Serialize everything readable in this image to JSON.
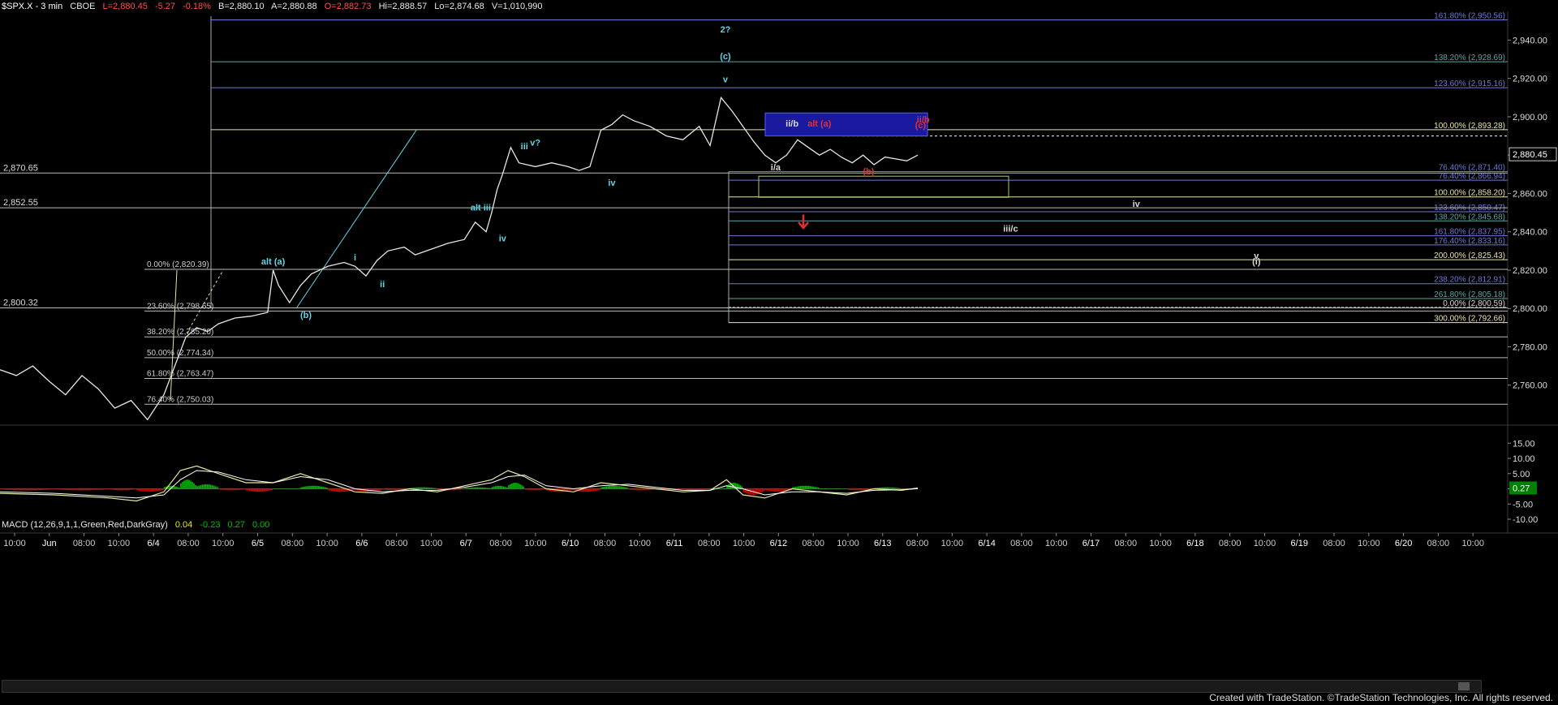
{
  "header": {
    "symbol": "$SPX.X - 3 min",
    "exchange": "CBOE",
    "last": "L=2,880.45",
    "change": "-5.27",
    "change_pct": "-0.18%",
    "bid": "B=2,880.10",
    "ask": "A=2,880.88",
    "open": "O=2,882.73",
    "high": "Hi=2,888.57",
    "low": "Lo=2,874.68",
    "volume": "V=1,010,990"
  },
  "macd_header": {
    "label": "MACD (12,26,9,1,1,Green,Red,DarkGray)",
    "v1": "0.04",
    "v2": "-0.23",
    "v3": "0.27",
    "v4": "0.00"
  },
  "footer": {
    "text": "Created with TradeStation. ©TradeStation Technologies, Inc. All rights reserved."
  },
  "colors": {
    "background": "#000000",
    "price": "#e6e6e6",
    "wave_label": "#5fd6e6",
    "red_label": "#e03030",
    "fib_blue": "#6f78d8",
    "fib_yellow": "#e6e6a8",
    "fib_white": "#d8d8d8",
    "macd_pos": "#00c000",
    "macd_neg": "#e00000"
  },
  "chart_data": [
    {
      "type": "line",
      "title": "$SPX.X - 3 min",
      "ylim": [
        2740,
        2955
      ],
      "y_ticks": [
        "2,760.00",
        "2,780.00",
        "2,800.00",
        "2,820.00",
        "2,840.00",
        "2,860.00",
        "2,880.00",
        "2,900.00",
        "2,920.00",
        "2,940.00"
      ],
      "x_ticks": [
        "10:00",
        "Jun",
        "08:00",
        "10:00",
        "6/4",
        "08:00",
        "10:00",
        "6/5",
        "08:00",
        "10:00",
        "6/6",
        "08:00",
        "10:00",
        "6/7",
        "08:00",
        "10:00",
        "6/10",
        "08:00",
        "10:00",
        "6/11",
        "08:00",
        "10:00",
        "6/12",
        "08:00",
        "10:00",
        "6/13",
        "08:00",
        "10:00",
        "6/14",
        "08:00",
        "10:00",
        "6/17",
        "08:00",
        "10:00",
        "6/18",
        "08:00",
        "10:00",
        "6/19",
        "08:00",
        "10:00",
        "6/20",
        "08:00",
        "10:00"
      ],
      "last_price": "2,880.45",
      "price_series": [
        [
          0,
          2768
        ],
        [
          0.3,
          2765
        ],
        [
          0.6,
          2770
        ],
        [
          0.9,
          2762
        ],
        [
          1.2,
          2755
        ],
        [
          1.5,
          2765
        ],
        [
          1.8,
          2758
        ],
        [
          2.1,
          2748
        ],
        [
          2.4,
          2752
        ],
        [
          2.7,
          2742
        ],
        [
          3.0,
          2755
        ],
        [
          3.2,
          2770
        ],
        [
          3.4,
          2785
        ],
        [
          3.6,
          2790
        ],
        [
          3.8,
          2788
        ],
        [
          4.0,
          2792
        ],
        [
          4.3,
          2795
        ],
        [
          4.6,
          2796
        ],
        [
          4.9,
          2798
        ],
        [
          5.0,
          2820
        ],
        [
          5.1,
          2812
        ],
        [
          5.3,
          2803
        ],
        [
          5.5,
          2812
        ],
        [
          5.7,
          2818
        ],
        [
          6.0,
          2822
        ],
        [
          6.3,
          2824
        ],
        [
          6.5,
          2822
        ],
        [
          6.7,
          2817
        ],
        [
          6.9,
          2825
        ],
        [
          7.1,
          2830
        ],
        [
          7.4,
          2832
        ],
        [
          7.6,
          2828
        ],
        [
          7.9,
          2831
        ],
        [
          8.2,
          2834
        ],
        [
          8.5,
          2836
        ],
        [
          8.7,
          2845
        ],
        [
          8.9,
          2840
        ],
        [
          9.0,
          2850
        ],
        [
          9.1,
          2862
        ],
        [
          9.2,
          2870
        ],
        [
          9.35,
          2884
        ],
        [
          9.5,
          2876
        ],
        [
          9.8,
          2874
        ],
        [
          10.1,
          2876
        ],
        [
          10.4,
          2874
        ],
        [
          10.6,
          2872
        ],
        [
          10.8,
          2874
        ],
        [
          11.0,
          2893
        ],
        [
          11.2,
          2896
        ],
        [
          11.4,
          2901
        ],
        [
          11.6,
          2898
        ],
        [
          11.9,
          2895
        ],
        [
          12.2,
          2890
        ],
        [
          12.5,
          2888
        ],
        [
          12.8,
          2895
        ],
        [
          13.0,
          2885
        ],
        [
          13.2,
          2910
        ],
        [
          13.4,
          2903
        ],
        [
          13.6,
          2895
        ],
        [
          13.8,
          2887
        ],
        [
          14.0,
          2880
        ],
        [
          14.2,
          2876
        ],
        [
          14.4,
          2880
        ],
        [
          14.6,
          2888
        ],
        [
          14.8,
          2884
        ],
        [
          15.0,
          2880
        ],
        [
          15.2,
          2883
        ],
        [
          15.4,
          2879
        ],
        [
          15.6,
          2876
        ],
        [
          15.8,
          2880
        ],
        [
          16.0,
          2875
        ],
        [
          16.2,
          2879
        ],
        [
          16.4,
          2878
        ],
        [
          16.6,
          2877
        ],
        [
          16.8,
          2880
        ]
      ],
      "fib_levels": [
        {
          "label": "161.80% (2,950.56)",
          "value": 2950.56,
          "color": "#6f78d8"
        },
        {
          "label": "138.20% (2,928.69)",
          "value": 2928.69,
          "color": "#5aa7a7"
        },
        {
          "label": "123.60% (2,915.16)",
          "value": 2915.16,
          "color": "#6f78d8"
        },
        {
          "label": "100.00% (2,893.28)",
          "value": 2893.28,
          "color": "#e6e6a8"
        },
        {
          "label": "76.40% (2,871.40)",
          "value": 2871.4,
          "color": "#6f78d8"
        },
        {
          "label": "76.40% (2,866.94)",
          "value": 2866.94,
          "color": "#6f78d8"
        },
        {
          "label": "100.00% (2,858.20)",
          "value": 2858.2,
          "color": "#e6e6a8"
        },
        {
          "label": "123.60% (2,850.47)",
          "value": 2850.47,
          "color": "#6f78d8"
        },
        {
          "label": "138.20% (2,845.68)",
          "value": 2845.68,
          "color": "#5aa7a7"
        },
        {
          "label": "161.80% (2,837.95)",
          "value": 2837.95,
          "color": "#6f78d8"
        },
        {
          "label": "176.40% (2,833.16)",
          "value": 2833.16,
          "color": "#6f78d8"
        },
        {
          "label": "200.00% (2,825.43)",
          "value": 2825.43,
          "color": "#e6e6a8"
        },
        {
          "label": "238.20% (2,812.91)",
          "value": 2812.91,
          "color": "#6f78d8"
        },
        {
          "label": "261.80% (2,805.18)",
          "value": 2805.18,
          "color": "#5aa7a7"
        },
        {
          "label": "0.00% (2,800.59)",
          "value": 2800.59,
          "color": "#d8d8d8"
        },
        {
          "label": "300.00% (2,792.66)",
          "value": 2792.66,
          "color": "#e6e6a8"
        }
      ],
      "left_fib_levels": [
        {
          "label": "0.00% (2,820.39)",
          "value": 2820.39
        },
        {
          "label": "23.60% (2,798.65)",
          "value": 2798.65
        },
        {
          "label": "38.20% (2,785.20)",
          "value": 2785.2
        },
        {
          "label": "50.00% (2,774.34)",
          "value": 2774.34
        },
        {
          "label": "61.80% (2,763.47)",
          "value": 2763.47
        },
        {
          "label": "76.40% (2,750.03)",
          "value": 2750.03
        }
      ],
      "left_price_labels": [
        {
          "label": "2,870.65",
          "value": 2870.65
        },
        {
          "label": "2,852.55",
          "value": 2852.55
        },
        {
          "label": "2,800.32",
          "value": 2800.32
        }
      ],
      "wave_labels": [
        {
          "text": "2?",
          "x": 13.28,
          "y": 2944,
          "color": "#5fd6e6"
        },
        {
          "text": "(c)",
          "x": 13.28,
          "y": 2930,
          "color": "#5fd6e6"
        },
        {
          "text": "v",
          "x": 13.28,
          "y": 2918,
          "color": "#5fd6e6"
        },
        {
          "text": "alt (a)",
          "x": 5.0,
          "y": 2823,
          "color": "#5fd6e6"
        },
        {
          "text": "(b)",
          "x": 5.6,
          "y": 2795,
          "color": "#5fd6e6"
        },
        {
          "text": "i",
          "x": 6.5,
          "y": 2825,
          "color": "#5fd6e6"
        },
        {
          "text": "ii",
          "x": 7.0,
          "y": 2811,
          "color": "#5fd6e6"
        },
        {
          "text": "iii",
          "x": 9.6,
          "y": 2883,
          "color": "#5fd6e6"
        },
        {
          "text": "v?",
          "x": 9.8,
          "y": 2885,
          "color": "#5fd6e6"
        },
        {
          "text": "iv",
          "x": 11.2,
          "y": 2864,
          "color": "#5fd6e6"
        },
        {
          "text": "alt iii",
          "x": 8.8,
          "y": 2851,
          "color": "#5fd6e6"
        },
        {
          "text": "iv",
          "x": 9.2,
          "y": 2835,
          "color": "#5fd6e6"
        },
        {
          "text": "i/a",
          "x": 14.2,
          "y": 2872,
          "color": "#d8d8d8"
        },
        {
          "text": "ii/b",
          "x": 14.5,
          "y": 2895,
          "color": "#d8d8d8"
        },
        {
          "text": "alt (a)",
          "x": 15.0,
          "y": 2895,
          "color": "#e03030"
        },
        {
          "text": "(b)",
          "x": 15.9,
          "y": 2870,
          "color": "#e03030"
        },
        {
          "text": "ii/b",
          "x": 16.9,
          "y": 2897,
          "color": "#e03030"
        },
        {
          "text": "(c)",
          "x": 16.85,
          "y": 2894,
          "color": "#e03030"
        },
        {
          "text": "iv",
          "x": 20.8,
          "y": 2853,
          "color": "#d8d8d8"
        },
        {
          "text": "iii/c",
          "x": 18.5,
          "y": 2840,
          "color": "#d8d8d8"
        },
        {
          "text": "v",
          "x": 23.0,
          "y": 2826,
          "color": "#d8d8d8"
        },
        {
          "text": "(i)",
          "x": 23.0,
          "y": 2823,
          "color": "#d8d8d8"
        }
      ]
    },
    {
      "type": "bar",
      "title": "MACD (12,26,9,1,1,Green,Red,DarkGray)",
      "ylim": [
        -14,
        18
      ],
      "y_ticks": [
        "15.00",
        "10.00",
        "5.00",
        "0.00",
        "-5.00",
        "-10.00"
      ],
      "last_value": "0.27",
      "macd_line": [
        [
          0,
          -1.5
        ],
        [
          1,
          -2
        ],
        [
          2,
          -3
        ],
        [
          2.5,
          -4
        ],
        [
          3,
          -1
        ],
        [
          3.3,
          6
        ],
        [
          3.6,
          7.5
        ],
        [
          4,
          5
        ],
        [
          4.5,
          2
        ],
        [
          5,
          2
        ],
        [
          5.5,
          5
        ],
        [
          6,
          2
        ],
        [
          6.5,
          -1
        ],
        [
          7,
          -1.5
        ],
        [
          7.5,
          0
        ],
        [
          8,
          -1
        ],
        [
          8.5,
          1
        ],
        [
          9,
          3
        ],
        [
          9.3,
          6
        ],
        [
          9.6,
          4
        ],
        [
          10,
          0
        ],
        [
          10.5,
          -1
        ],
        [
          11,
          2
        ],
        [
          11.5,
          1
        ],
        [
          12,
          0
        ],
        [
          12.5,
          -1
        ],
        [
          13,
          -0.5
        ],
        [
          13.3,
          3
        ],
        [
          13.6,
          -2
        ],
        [
          14,
          -3
        ],
        [
          14.5,
          0
        ],
        [
          15,
          -1
        ],
        [
          15.5,
          -2
        ],
        [
          16,
          0
        ],
        [
          16.5,
          -0.5
        ],
        [
          16.8,
          0.27
        ]
      ],
      "signal_line": [
        [
          0,
          -1
        ],
        [
          1,
          -1.5
        ],
        [
          2,
          -2.5
        ],
        [
          2.5,
          -3
        ],
        [
          3,
          -2
        ],
        [
          3.3,
          3
        ],
        [
          3.6,
          6
        ],
        [
          4,
          5.5
        ],
        [
          4.5,
          3
        ],
        [
          5,
          2
        ],
        [
          5.5,
          4
        ],
        [
          6,
          3
        ],
        [
          6.5,
          0
        ],
        [
          7,
          -1
        ],
        [
          7.5,
          -0.5
        ],
        [
          8,
          -0.5
        ],
        [
          8.5,
          0.5
        ],
        [
          9,
          2
        ],
        [
          9.3,
          4
        ],
        [
          9.6,
          4.5
        ],
        [
          10,
          1
        ],
        [
          10.5,
          0
        ],
        [
          11,
          1
        ],
        [
          11.5,
          1.5
        ],
        [
          12,
          0.5
        ],
        [
          12.5,
          -0.5
        ],
        [
          13,
          -0.5
        ],
        [
          13.3,
          1
        ],
        [
          13.6,
          0
        ],
        [
          14,
          -2
        ],
        [
          14.5,
          -1
        ],
        [
          15,
          -1
        ],
        [
          15.5,
          -1.5
        ],
        [
          16,
          -0.5
        ],
        [
          16.5,
          -0.3
        ],
        [
          16.8,
          0.04
        ]
      ]
    }
  ]
}
